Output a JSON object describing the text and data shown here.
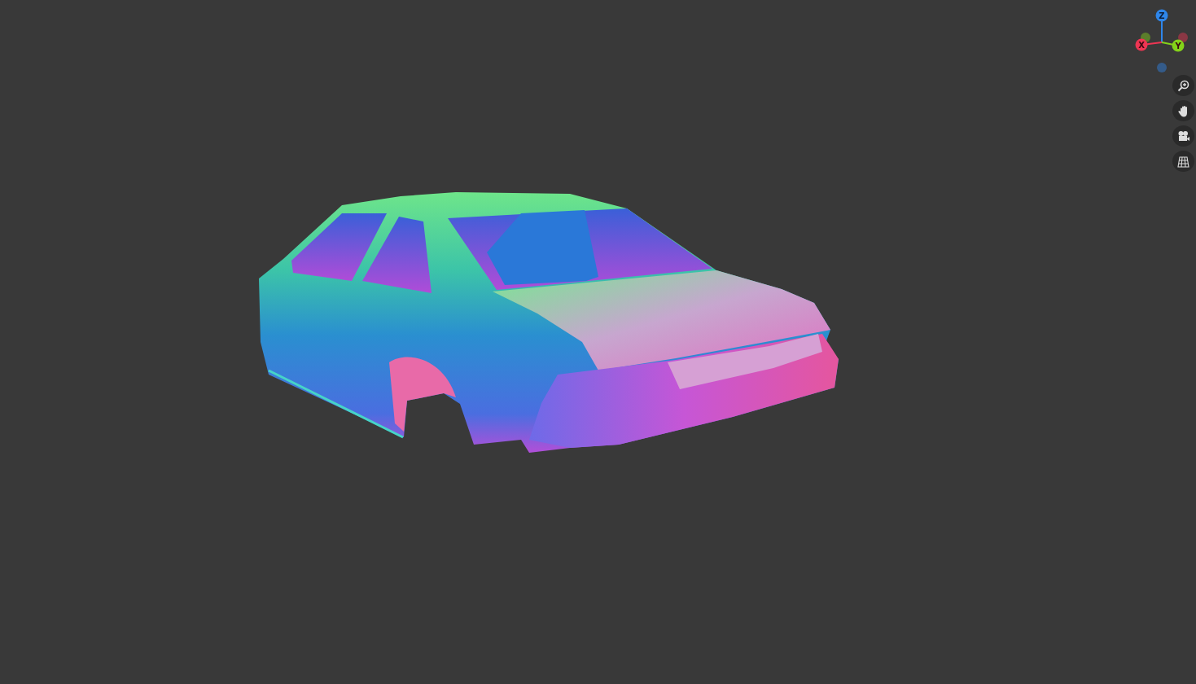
{
  "viewport": {
    "model": {
      "kind": "car-body"
    }
  },
  "gizmo": {
    "axes": [
      {
        "kind": "z",
        "label": "Z",
        "color": "#2e86ea"
      },
      {
        "kind": "x",
        "label": "X",
        "color": "#ee3553"
      },
      {
        "kind": "y",
        "label": "Y",
        "color": "#84d21a"
      }
    ]
  },
  "tools": [
    {
      "kind": "zoom"
    },
    {
      "kind": "pan"
    },
    {
      "kind": "camera"
    },
    {
      "kind": "grid"
    }
  ]
}
